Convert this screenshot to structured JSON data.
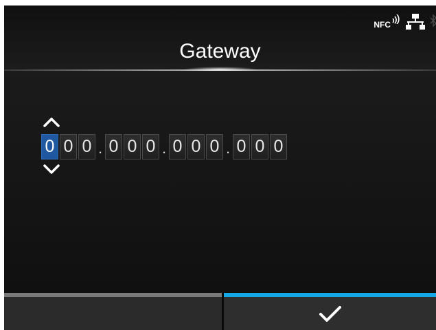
{
  "header": {
    "title": "Gateway",
    "status_icons": {
      "nfc_label": "NFC",
      "nfc_icon": "nfc-icon",
      "network_icon": "network-icon",
      "bluetooth_icon": "bluetooth-icon"
    }
  },
  "gateway": {
    "digits": [
      "0",
      "0",
      "0",
      "0",
      "0",
      "0",
      "0",
      "0",
      "0",
      "0",
      "0",
      "0"
    ],
    "separator": ".",
    "selected_digit_index": 0,
    "up_icon": "chevron-up-icon",
    "down_icon": "chevron-down-icon"
  },
  "footer": {
    "left_button_icon": "",
    "right_button_icon": "checkmark-icon"
  },
  "colors": {
    "selected_digit": "#1f58a0",
    "confirm_accent": "#14a8e6",
    "cancel_accent": "#7a7a7a",
    "background": "#161616"
  }
}
